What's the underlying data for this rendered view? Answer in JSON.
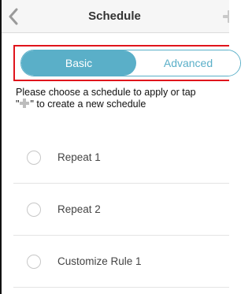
{
  "header": {
    "title": "Schedule",
    "back_icon": "chevron-left-icon",
    "add_icon": "plus-icon"
  },
  "tabs": [
    {
      "label": "Basic",
      "active": true
    },
    {
      "label": "Advanced",
      "active": false
    }
  ],
  "instruction": {
    "line1": "Please choose a schedule to apply or tap",
    "line2_prefix": "\"",
    "line2_suffix": "\" to create a new schedule"
  },
  "schedules": [
    {
      "label": "Repeat 1",
      "selected": false
    },
    {
      "label": "Repeat 2",
      "selected": false
    },
    {
      "label": "Customize Rule 1",
      "selected": false
    }
  ],
  "colors": {
    "accent": "#5aafc8",
    "highlight_border": "#e0141c",
    "plus_gray": "#c9c9c9"
  }
}
